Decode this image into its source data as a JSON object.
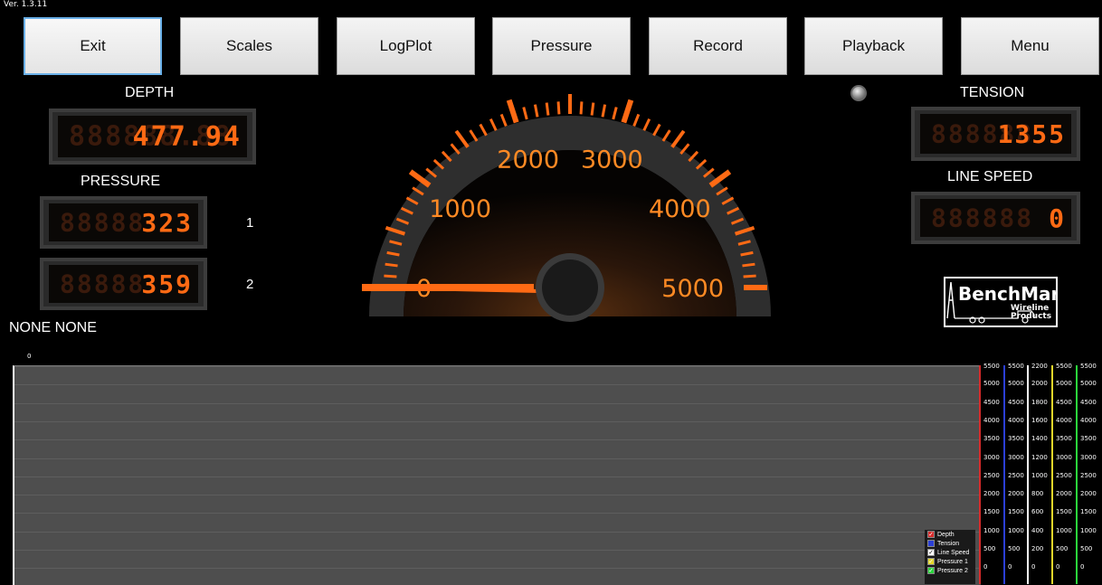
{
  "app": {
    "version": "Ver. 1.3.11"
  },
  "toolbar": {
    "buttons": [
      {
        "label": "Exit"
      },
      {
        "label": "Scales"
      },
      {
        "label": "LogPlot"
      },
      {
        "label": "Pressure"
      },
      {
        "label": "Record"
      },
      {
        "label": "Playback"
      },
      {
        "label": "Menu"
      }
    ]
  },
  "readouts": {
    "depth": {
      "label": "DEPTH",
      "value": "477.94",
      "ghost": "888888.88"
    },
    "pressure": {
      "label": "PRESSURE"
    },
    "pressure1": {
      "value": "323",
      "ghost": "88888",
      "channel": "1"
    },
    "pressure2": {
      "value": "359",
      "ghost": "88888",
      "channel": "2"
    },
    "tension": {
      "label": "TENSION",
      "value": "1355",
      "ghost": "888888"
    },
    "line_speed": {
      "label": "LINE SPEED",
      "value": "0",
      "ghost": "888888"
    },
    "status": "NONE NONE"
  },
  "gauge": {
    "labels": [
      "0",
      "1000",
      "2000",
      "3000",
      "4000",
      "5000"
    ],
    "min": 0,
    "max": 5000,
    "value": 0
  },
  "logo": {
    "brand": "BenchMark",
    "sub1": "Wireline",
    "sub2": "Products"
  },
  "plot": {
    "x_label": "0",
    "scales": [
      {
        "color": "#d62a2a",
        "ticks": [
          "5500",
          "5000",
          "4500",
          "4000",
          "3500",
          "3000",
          "2500",
          "2000",
          "1500",
          "1000",
          "500",
          "0"
        ]
      },
      {
        "color": "#2b3fd6",
        "ticks": [
          "5500",
          "5000",
          "4500",
          "4000",
          "3500",
          "3000",
          "2500",
          "2000",
          "1500",
          "1000",
          "500",
          "0"
        ]
      },
      {
        "color": "#ffffff",
        "ticks": [
          "2200",
          "2000",
          "1800",
          "1600",
          "1400",
          "1200",
          "1000",
          "800",
          "600",
          "400",
          "200",
          "0"
        ]
      },
      {
        "color": "#e2d62a",
        "ticks": [
          "5500",
          "5000",
          "4500",
          "4000",
          "3500",
          "3000",
          "2500",
          "2000",
          "1500",
          "1000",
          "500",
          "0"
        ]
      },
      {
        "color": "#2ad63c",
        "ticks": [
          "5500",
          "5000",
          "4500",
          "4000",
          "3500",
          "3000",
          "2500",
          "2000",
          "1500",
          "1000",
          "500",
          "0"
        ]
      }
    ],
    "legend": [
      {
        "label": "Depth",
        "color": "#d62a2a",
        "checked": true
      },
      {
        "label": "Tension",
        "color": "#2b3fd6",
        "checked": false
      },
      {
        "label": "Line Speed",
        "color": "#ffffff",
        "checked": true
      },
      {
        "label": "Pressure 1",
        "color": "#e2d62a",
        "checked": true
      },
      {
        "label": "Pressure 2",
        "color": "#2ad63c",
        "checked": true
      }
    ]
  }
}
